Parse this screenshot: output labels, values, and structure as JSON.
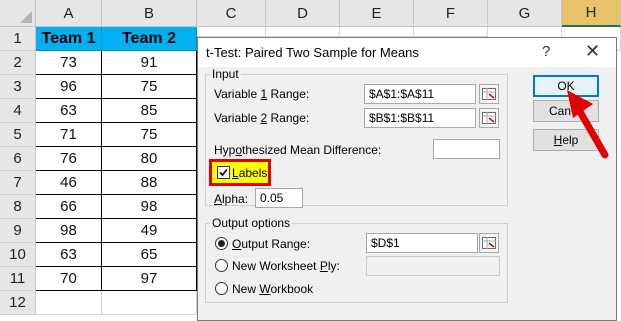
{
  "spreadsheet": {
    "columns": [
      "A",
      "B",
      "C",
      "D",
      "E",
      "F",
      "G",
      "H"
    ],
    "selected_column": "H",
    "rows": [
      "1",
      "2",
      "3",
      "4",
      "5",
      "6",
      "7",
      "8",
      "9",
      "10",
      "11",
      "12"
    ],
    "headers": [
      "Team 1",
      "Team 2"
    ],
    "team1": [
      "73",
      "96",
      "63",
      "71",
      "76",
      "46",
      "66",
      "98",
      "63",
      "70"
    ],
    "team2": [
      "91",
      "75",
      "85",
      "75",
      "80",
      "88",
      "98",
      "49",
      "65",
      "97"
    ]
  },
  "dialog": {
    "title": "t-Test: Paired Two Sample for Means",
    "help_glyph": "?",
    "close_glyph": "✕",
    "input_group": "Input",
    "var1_label_pre": "Variable ",
    "var1_label_u": "1",
    "var1_label_post": " Range:",
    "var1_value": "$A$1:$A$11",
    "var2_label_pre": "Variable ",
    "var2_label_u": "2",
    "var2_label_post": " Range:",
    "var2_value": "$B$1:$B$11",
    "hyp_label_pre": "Hyp",
    "hyp_label_u": "o",
    "hyp_label_post": "thesized Mean Difference:",
    "hyp_value": "",
    "labels_u": "L",
    "labels_post": "abels",
    "labels_checked": true,
    "alpha_u": "A",
    "alpha_post": "lpha:",
    "alpha_value": "0.05",
    "output_group": "Output options",
    "out_range_u": "O",
    "out_range_post": "utput Range:",
    "out_range_value": "$D$1",
    "new_ply_pre": "New Worksheet ",
    "new_ply_u": "P",
    "new_ply_post": "ly:",
    "new_wb_pre": "New ",
    "new_wb_u": "W",
    "new_wb_post": "orkbook",
    "ok_label": "OK",
    "cancel_label": "Can",
    "help_pre": "",
    "help_u": "H",
    "help_post": "elp"
  },
  "colors": {
    "header_fill": "#00b0f0",
    "selected_col": "#e8c26b",
    "highlight_border": "#e00000",
    "highlight_fill": "#ffff00",
    "arrow": "#e00000"
  }
}
